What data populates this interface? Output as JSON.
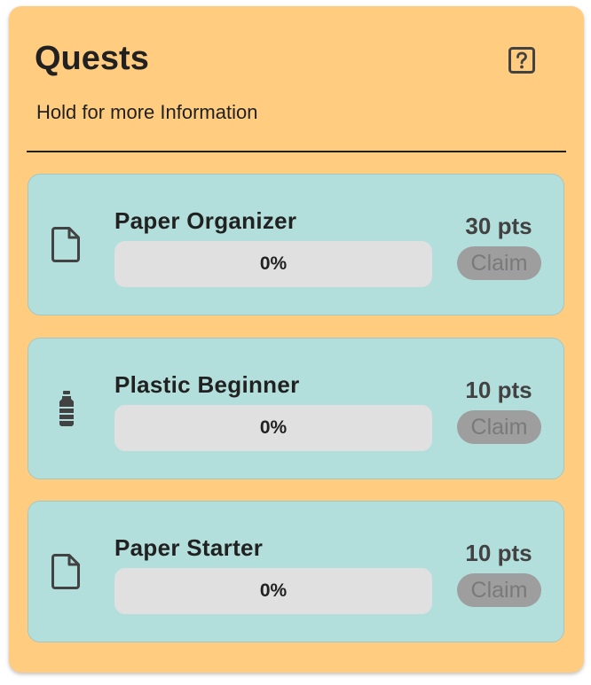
{
  "header": {
    "title": "Quests",
    "subtitle": "Hold for more Information",
    "help_icon": "help-box-icon"
  },
  "colors": {
    "card_bg": "#ffcc80",
    "quest_bg": "#b2dfdb",
    "progress_bg": "#e0e0e0",
    "claim_disabled_bg": "#9e9e9e",
    "text": "#212121"
  },
  "quests": [
    {
      "icon": "file-icon",
      "name": "Paper Organizer",
      "progress_label": "0%",
      "progress": 0,
      "points": "30 pts",
      "claim_label": "Claim",
      "claim_enabled": false
    },
    {
      "icon": "bottle-icon",
      "name": "Plastic Beginner",
      "progress_label": "0%",
      "progress": 0,
      "points": "10 pts",
      "claim_label": "Claim",
      "claim_enabled": false
    },
    {
      "icon": "file-icon",
      "name": "Paper Starter",
      "progress_label": "0%",
      "progress": 0,
      "points": "10 pts",
      "claim_label": "Claim",
      "claim_enabled": false
    }
  ]
}
